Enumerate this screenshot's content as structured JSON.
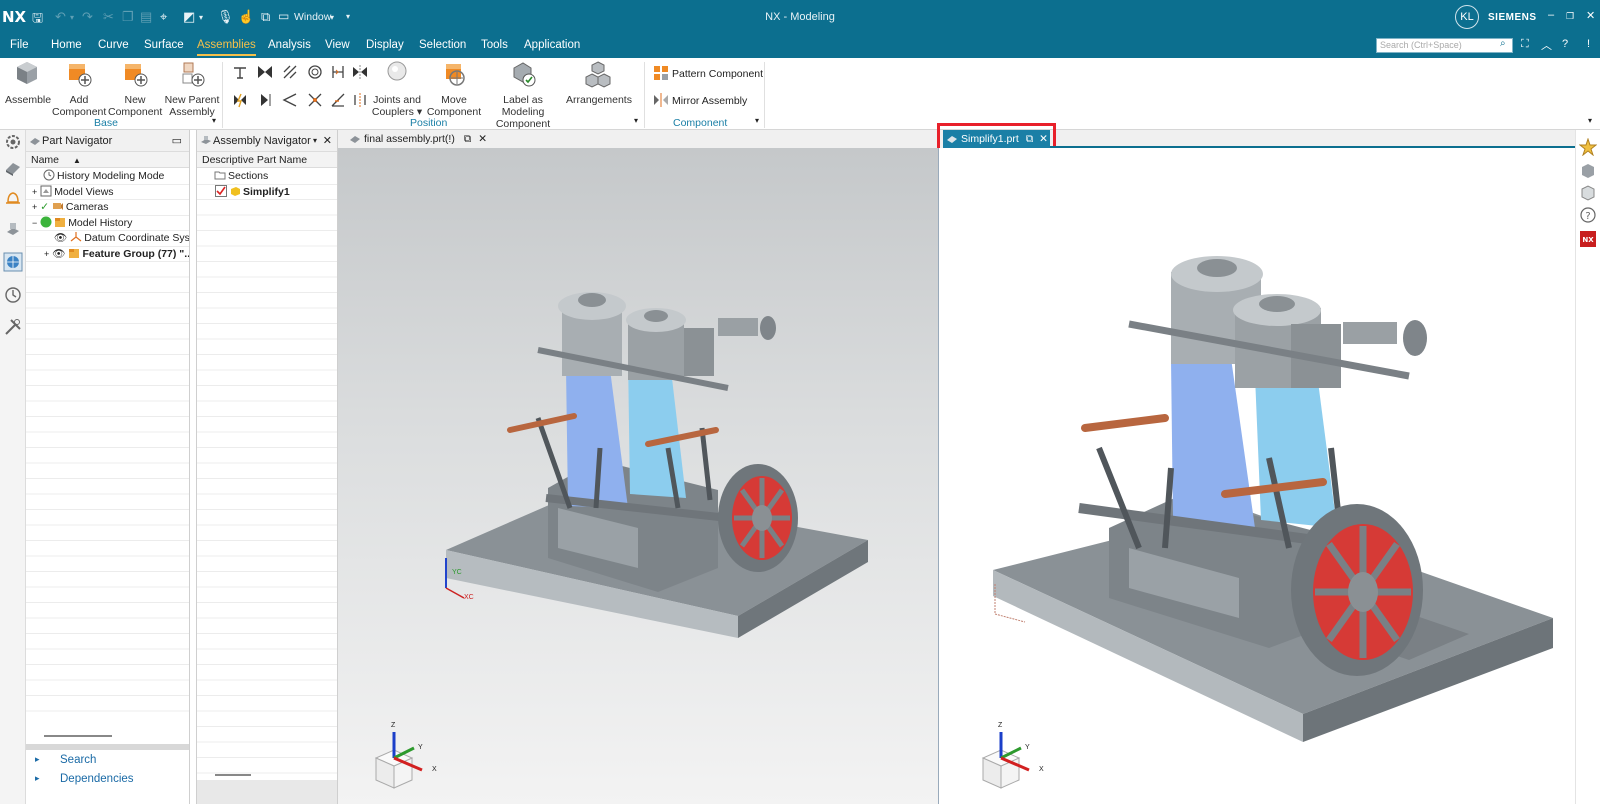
{
  "app": {
    "logo": "NX",
    "window_title": "NX - Modeling",
    "window_menu": "Window",
    "user_initials": "KL",
    "brand": "SIEMENS"
  },
  "menu": {
    "items": [
      "File",
      "Home",
      "Curve",
      "Surface",
      "Assemblies",
      "Analysis",
      "View",
      "Display",
      "Selection",
      "Tools",
      "Application"
    ],
    "active": "Assemblies",
    "search_placeholder": "Search (Ctrl+Space)"
  },
  "ribbon": {
    "base": {
      "label": "Base",
      "buttons": [
        {
          "line1": "Assemble",
          "line2": ""
        },
        {
          "line1": "Add",
          "line2": "Component"
        },
        {
          "line1": "New",
          "line2": "Component"
        },
        {
          "line1": "New Parent",
          "line2": "Assembly"
        }
      ]
    },
    "position": {
      "label": "Position",
      "buttons": [
        {
          "line1": "Joints and",
          "line2": "Couplers"
        },
        {
          "line1": "Move",
          "line2": "Component"
        },
        {
          "line1": "Label as Modeling",
          "line2": "Component"
        },
        {
          "line1": "Arrangements",
          "line2": ""
        }
      ]
    },
    "component": {
      "label": "Component",
      "buttons": [
        "Pattern Component",
        "Mirror Assembly"
      ]
    }
  },
  "part_navigator": {
    "title": "Part Navigator",
    "column": "Name",
    "rows": [
      "History Modeling Mode",
      "Model Views",
      "Cameras",
      "Model History",
      "Datum Coordinate Syst...",
      "Feature Group (77) \"..."
    ],
    "links": [
      "Search",
      "Dependencies"
    ]
  },
  "assembly_navigator": {
    "title": "Assembly Navigator",
    "column": "Descriptive Part Name",
    "rows": [
      "Sections",
      "Simplify1"
    ]
  },
  "tabs": {
    "left": "final assembly.prt(!)",
    "right": "Simplify1.prt"
  },
  "viewport_left": {
    "axis": {
      "z": "Z",
      "y": "Y",
      "x": "X",
      "yc": "YC",
      "xc": "XC"
    }
  },
  "viewport_right": {
    "axis": {
      "z": "Z",
      "y": "Y",
      "x": "X"
    }
  },
  "colors": {
    "titlebar": "#0c6f8f",
    "accent": "#f5c04a",
    "highlight": "#e8202a",
    "body_blue": "#8fb0ee",
    "body_cyan": "#8ccdee",
    "lever_brown": "#b8663f",
    "spoke_red": "#d63a36",
    "steel": "#8c9296"
  }
}
